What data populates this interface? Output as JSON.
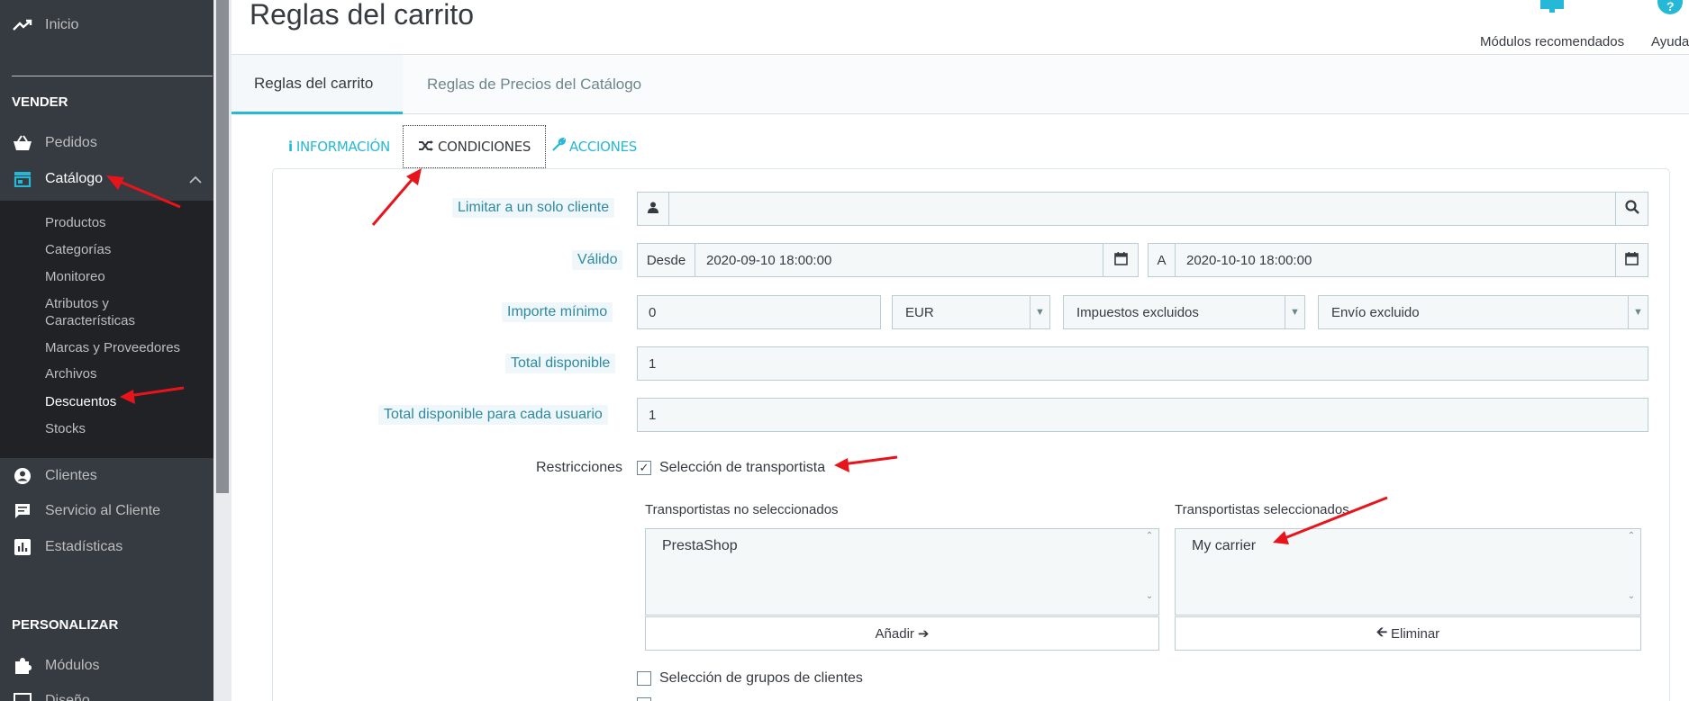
{
  "sidebar": {
    "home": "Inicio",
    "section_sell": "VENDER",
    "orders": "Pedidos",
    "catalog": "Catálogo",
    "catalog_sub": [
      "Productos",
      "Categorías",
      "Monitoreo",
      "Atributos y",
      "Características",
      "Marcas y Proveedores",
      "Archivos",
      "Descuentos",
      "Stocks"
    ],
    "customers": "Clientes",
    "customer_service": "Servicio al Cliente",
    "stats": "Estadísticas",
    "section_customize": "PERSONALIZAR",
    "modules": "Módulos",
    "design": "Diseño"
  },
  "header": {
    "title": "Reglas del carrito",
    "recommended_modules": "Módulos recomendados",
    "help": "Ayuda"
  },
  "page_tabs": [
    "Reglas del carrito",
    "Reglas de Precios del Catálogo"
  ],
  "form_tabs": [
    "INFORMACIÓN",
    "CONDICIONES",
    "ACCIONES"
  ],
  "form": {
    "limit_customer_label": "Limitar a un solo cliente",
    "limit_customer_value": "",
    "valid_label": "Válido",
    "from_label": "Desde",
    "from_value": "2020-09-10 18:00:00",
    "to_label": "A",
    "to_value": "2020-10-10 18:00:00",
    "min_amount_label": "Importe mínimo",
    "min_amount_value": "0",
    "currency": "EUR",
    "tax": "Impuestos excluidos",
    "shipping": "Envío excluido",
    "total_available_label": "Total disponible",
    "total_available_value": "1",
    "total_per_user_label": "Total disponible para cada usuario",
    "total_per_user_value": "1",
    "restrictions_label": "Restricciones",
    "carrier_restriction": "Selección de transportista",
    "unselected_title": "Transportistas no seleccionados",
    "selected_title": "Transportistas seleccionados",
    "unselected_carriers": [
      "PrestaShop"
    ],
    "selected_carriers": [
      "My carrier"
    ],
    "add_button": "Añadir",
    "remove_button": "Eliminar",
    "group_restriction": "Selección de grupos de clientes"
  },
  "colors": {
    "sidebar": "#363a41",
    "accent": "#25b9d7",
    "annotation": "#e8141b"
  }
}
